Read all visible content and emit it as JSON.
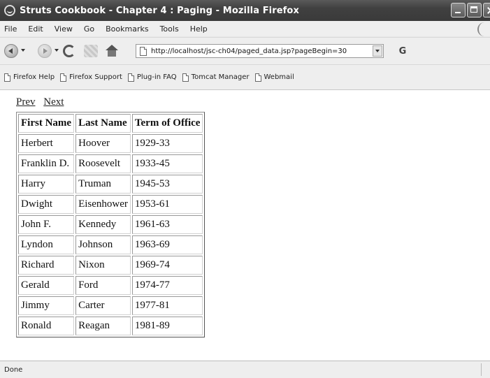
{
  "window": {
    "title": "Struts Cookbook - Chapter 4 : Paging - Mozilla Firefox"
  },
  "menubar": {
    "items": [
      "File",
      "Edit",
      "View",
      "Go",
      "Bookmarks",
      "Tools",
      "Help"
    ]
  },
  "navigation": {
    "url": "http://localhost/jsc-ch04/paged_data.jsp?pageBegin=30",
    "go_label": "G"
  },
  "bookmarks": {
    "items": [
      "Firefox Help",
      "Firefox Support",
      "Plug-in FAQ",
      "Tomcat Manager",
      "Webmail"
    ]
  },
  "pager": {
    "prev_label": "Prev",
    "next_label": "Next"
  },
  "table": {
    "headers": [
      "First Name",
      "Last Name",
      "Term of Office"
    ],
    "rows": [
      [
        "Herbert",
        "Hoover",
        "1929-33"
      ],
      [
        "Franklin D.",
        "Roosevelt",
        "1933-45"
      ],
      [
        "Harry",
        "Truman",
        "1945-53"
      ],
      [
        "Dwight",
        "Eisenhower",
        "1953-61"
      ],
      [
        "John F.",
        "Kennedy",
        "1961-63"
      ],
      [
        "Lyndon",
        "Johnson",
        "1963-69"
      ],
      [
        "Richard",
        "Nixon",
        "1969-74"
      ],
      [
        "Gerald",
        "Ford",
        "1974-77"
      ],
      [
        "Jimmy",
        "Carter",
        "1977-81"
      ],
      [
        "Ronald",
        "Reagan",
        "1981-89"
      ]
    ]
  },
  "status": {
    "text": "Done"
  }
}
